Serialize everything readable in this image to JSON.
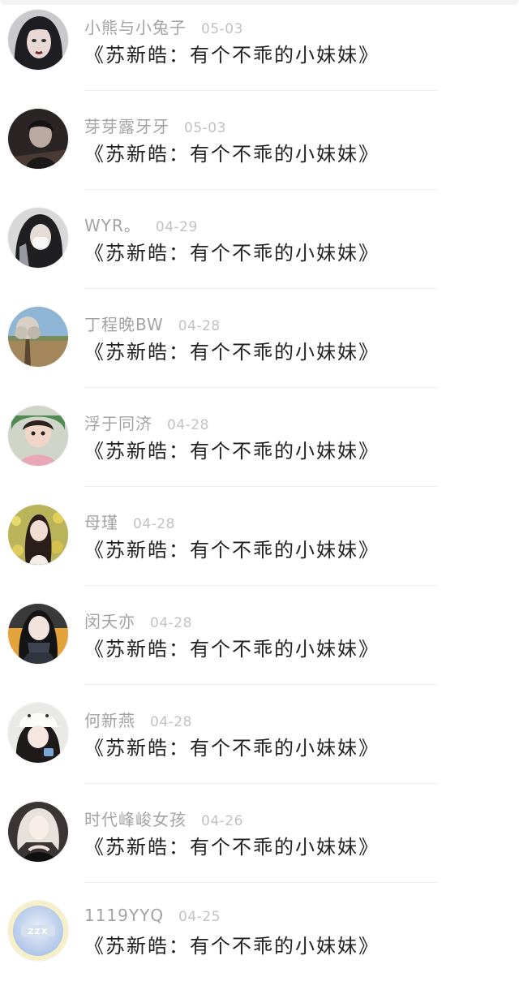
{
  "comments": [
    {
      "username": "小熊与小兔子",
      "date": "05-03",
      "text": "《苏新皓：有个不乖的小妹妹》",
      "avatar": "avatar-dark-hair-illustration-icon"
    },
    {
      "username": "芽芽露牙牙",
      "date": "05-03",
      "text": "《苏新皓：有个不乖的小妹妹》",
      "avatar": "avatar-dark-portrait-icon"
    },
    {
      "username": "WYR。",
      "date": "04-29",
      "text": "《苏新皓：有个不乖的小妹妹》",
      "avatar": "avatar-masked-girl-icon"
    },
    {
      "username": "丁程晚BW",
      "date": "04-28",
      "text": "《苏新皓：有个不乖的小妹妹》",
      "avatar": "avatar-landscape-tree-icon"
    },
    {
      "username": "浮于同济",
      "date": "04-28",
      "text": "《苏新皓：有个不乖的小妹妹》",
      "avatar": "avatar-child-icon"
    },
    {
      "username": "母瑾",
      "date": "04-28",
      "text": "《苏新皓：有个不乖的小妹妹》",
      "avatar": "avatar-girl-flowers-icon"
    },
    {
      "username": "闵夭亦",
      "date": "04-28",
      "text": "《苏新皓：有个不乖的小妹妹》",
      "avatar": "avatar-girl-scarf-icon"
    },
    {
      "username": "何新燕",
      "date": "04-28",
      "text": "《苏新皓：有个不乖的小妹妹》",
      "avatar": "avatar-girl-cap-icon"
    },
    {
      "username": "时代峰峻女孩",
      "date": "04-26",
      "text": "《苏新皓：有个不乖的小妹妹》",
      "avatar": "avatar-blonde-girl-icon"
    },
    {
      "username": "1119YYQ",
      "date": "04-25",
      "text": "《苏新皓：有个不乖的小妹妹》",
      "avatar": "avatar-zzx-logo-icon"
    }
  ],
  "zzx_logo_text": "ZZX",
  "colors": {
    "username": "#a3a3a3",
    "date": "#c2c2c2",
    "content": "#222222",
    "divider": "#f0f0f0"
  }
}
